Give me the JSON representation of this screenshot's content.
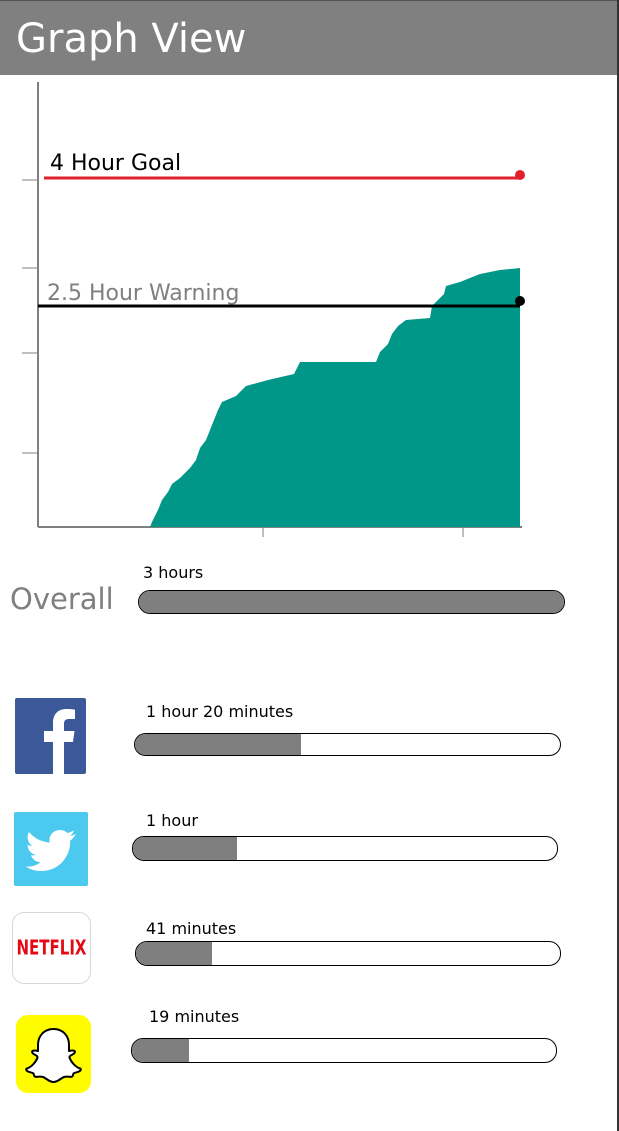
{
  "header": {
    "title": "Graph View"
  },
  "graph": {
    "goal_label": "4 Hour Goal",
    "warning_label": "2.5 Hour Warning",
    "colors": {
      "goal": "#e0202b",
      "warning": "#000000",
      "area": "#009688",
      "axis": "#7f7f7f"
    }
  },
  "overall": {
    "label": "Overall",
    "time_label": "3 hours",
    "fraction": 1.0
  },
  "apps": [
    {
      "icon": "facebook-icon",
      "time_label": "1 hour 20 minutes",
      "fraction": 0.39
    },
    {
      "icon": "twitter-icon",
      "time_label": "1 hour",
      "fraction": 0.245
    },
    {
      "icon": "netflix-icon",
      "time_label": "41 minutes",
      "fraction": 0.18,
      "icon_text": "NETFLIX"
    },
    {
      "icon": "snapchat-icon",
      "time_label": "19 minutes",
      "fraction": 0.135
    }
  ]
}
